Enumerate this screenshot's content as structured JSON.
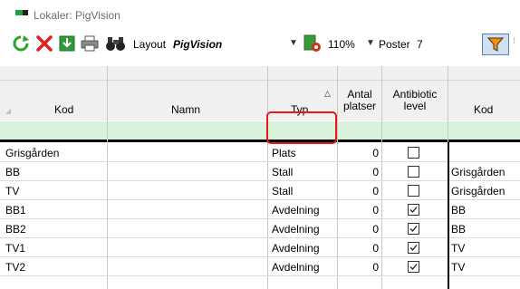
{
  "window": {
    "title": "Lokaler: PigVision"
  },
  "toolbar": {
    "layout_label": "Layout",
    "layout_value": "PigVision",
    "zoom": "110%",
    "poster_label": "Poster",
    "poster_count": "7"
  },
  "grid": {
    "columns": [
      {
        "name": "Kod"
      },
      {
        "name": "Namn"
      },
      {
        "name": "Typ"
      },
      {
        "name": "Antal platser"
      },
      {
        "name": "Antibiotic level"
      },
      {
        "name": "Kod"
      }
    ],
    "header_lines": {
      "antal_1": "Antal",
      "antal_2": "platser",
      "anti_1": "Antibiotic",
      "anti_2": "level"
    },
    "rows": [
      {
        "kod": "Grisgården",
        "namn": "",
        "typ": "Plats",
        "antal": "0",
        "checked": false,
        "parent": ""
      },
      {
        "kod": "BB",
        "namn": "",
        "typ": "Stall",
        "antal": "0",
        "checked": false,
        "parent": "Grisgården"
      },
      {
        "kod": "TV",
        "namn": "",
        "typ": "Stall",
        "antal": "0",
        "checked": false,
        "parent": "Grisgården"
      },
      {
        "kod": "BB1",
        "namn": "",
        "typ": "Avdelning",
        "antal": "0",
        "checked": true,
        "parent": "BB"
      },
      {
        "kod": "BB2",
        "namn": "",
        "typ": "Avdelning",
        "antal": "0",
        "checked": true,
        "parent": "BB"
      },
      {
        "kod": "TV1",
        "namn": "",
        "typ": "Avdelning",
        "antal": "0",
        "checked": true,
        "parent": "TV"
      },
      {
        "kod": "TV2",
        "namn": "",
        "typ": "Avdelning",
        "antal": "0",
        "checked": true,
        "parent": "TV"
      }
    ]
  },
  "colors": {
    "filter_row": "#d9f2d9",
    "highlight_box": "#e41a1a",
    "header_bg": "#f0f0f0"
  },
  "icons": [
    "refresh-icon",
    "delete-icon",
    "save-icon",
    "print-icon",
    "binoculars-icon",
    "layout-settings-icon",
    "filter-icon"
  ]
}
